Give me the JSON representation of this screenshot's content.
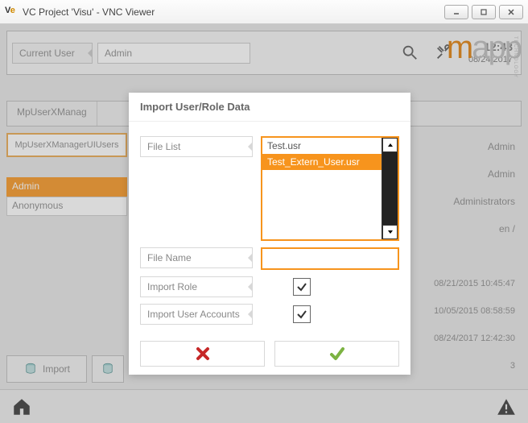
{
  "window": {
    "title": "VC Project 'Visu' - VNC Viewer"
  },
  "header": {
    "current_user_label": "Current User",
    "current_user_value": "Admin",
    "time": "12:43",
    "date": "08/24/2017"
  },
  "background": {
    "tab_title": "MpUserXManag",
    "side_tab": "MpUserXManagerUIUsers",
    "user_rows": [
      "Admin",
      "Anonymous"
    ],
    "right_meta": [
      "Admin",
      "Admin",
      "Administrators",
      "en /"
    ],
    "right_ts": [
      "08/21/2015 10:45:47",
      "10/05/2015 08:58:59",
      "08/24/2017 12:42:30",
      "3"
    ],
    "import_label": "Import"
  },
  "dialog": {
    "title": "Import User/Role Data",
    "file_list_label": "File List",
    "files": [
      "Test.usr",
      "Test_Extern_User.usr"
    ],
    "selected_file_index": 1,
    "file_name_label": "File Name",
    "file_name_value": "",
    "import_role_label": "Import Role",
    "import_role_checked": true,
    "import_user_label": "Import User Accounts",
    "import_user_checked": true
  }
}
